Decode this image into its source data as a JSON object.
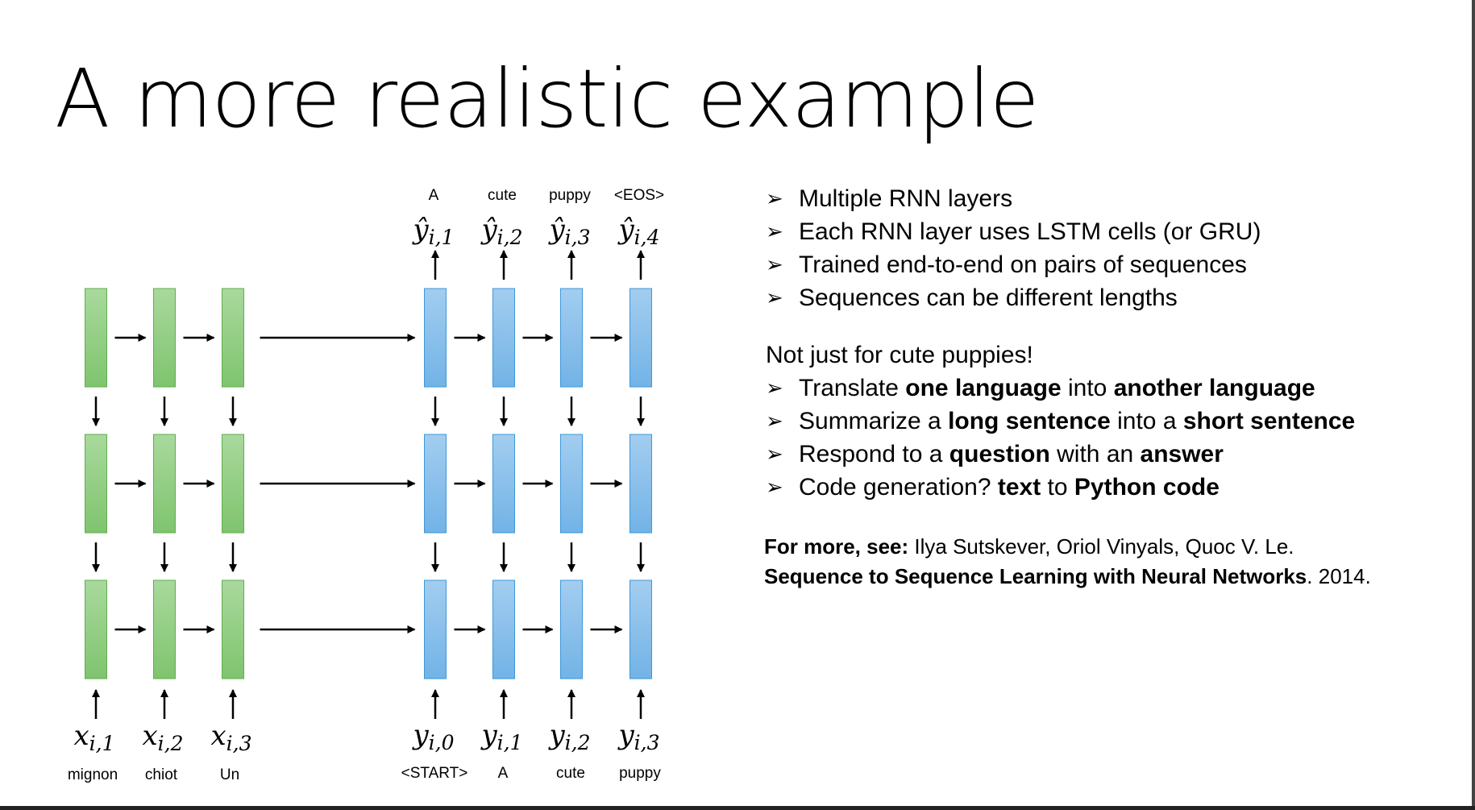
{
  "slide": {
    "title": "A more realistic example"
  },
  "diagram": {
    "encoder_inputs": [
      {
        "sym": "x",
        "sub": "i,1",
        "word": "mignon"
      },
      {
        "sym": "x",
        "sub": "i,2",
        "word": "chiot"
      },
      {
        "sym": "x",
        "sub": "i,3",
        "word": "Un"
      }
    ],
    "decoder_inputs": [
      {
        "sym": "y",
        "sub": "i,0",
        "word": "<START>"
      },
      {
        "sym": "y",
        "sub": "i,1",
        "word": "A"
      },
      {
        "sym": "y",
        "sub": "i,2",
        "word": "cute"
      },
      {
        "sym": "y",
        "sub": "i,3",
        "word": "puppy"
      }
    ],
    "decoder_outputs": [
      {
        "sym": "ŷ",
        "sub": "i,1",
        "word": "A"
      },
      {
        "sym": "ŷ",
        "sub": "i,2",
        "word": "cute"
      },
      {
        "sym": "ŷ",
        "sub": "i,3",
        "word": "puppy"
      },
      {
        "sym": "ŷ",
        "sub": "i,4",
        "word": "<EOS>"
      }
    ],
    "layers": 3,
    "encoder_color": "#8fcf7f",
    "decoder_color": "#7fbbe9"
  },
  "bullets": {
    "section1": [
      {
        "parts": [
          {
            "t": "Multiple RNN layers",
            "b": false
          }
        ]
      },
      {
        "parts": [
          {
            "t": "Each RNN layer uses LSTM cells (or GRU)",
            "b": false
          }
        ]
      },
      {
        "parts": [
          {
            "t": "Trained end-to-end on pairs of sequences",
            "b": false
          }
        ]
      },
      {
        "parts": [
          {
            "t": "Sequences can be different lengths",
            "b": false
          }
        ]
      }
    ],
    "lead": "Not just for cute puppies!",
    "section2": [
      {
        "parts": [
          {
            "t": "Translate ",
            "b": false
          },
          {
            "t": "one language",
            "b": true
          },
          {
            "t": " into ",
            "b": false
          },
          {
            "t": "another language",
            "b": true
          }
        ]
      },
      {
        "parts": [
          {
            "t": "Summarize a ",
            "b": false
          },
          {
            "t": "long sentence",
            "b": true
          },
          {
            "t": " into a ",
            "b": false
          },
          {
            "t": "short sentence",
            "b": true
          }
        ]
      },
      {
        "parts": [
          {
            "t": "Respond to a ",
            "b": false
          },
          {
            "t": "question",
            "b": true
          },
          {
            "t": " with an ",
            "b": false
          },
          {
            "t": "answer",
            "b": true
          }
        ]
      },
      {
        "parts": [
          {
            "t": "Code generation? ",
            "b": false
          },
          {
            "t": "text",
            "b": true
          },
          {
            "t": " to ",
            "b": false
          },
          {
            "t": "Python code",
            "b": true
          }
        ]
      }
    ]
  },
  "reference": {
    "line1_bold": "For more, see:",
    "line1_rest": " Ilya Sutskever, Oriol Vinyals, Quoc V. Le.",
    "line2_bold": "Sequence to Sequence Learning with Neural Networks",
    "line2_rest": ". 2014."
  },
  "icons": {
    "bullet": "arrowhead-bullet-icon",
    "bullet_glyph": "➢"
  }
}
